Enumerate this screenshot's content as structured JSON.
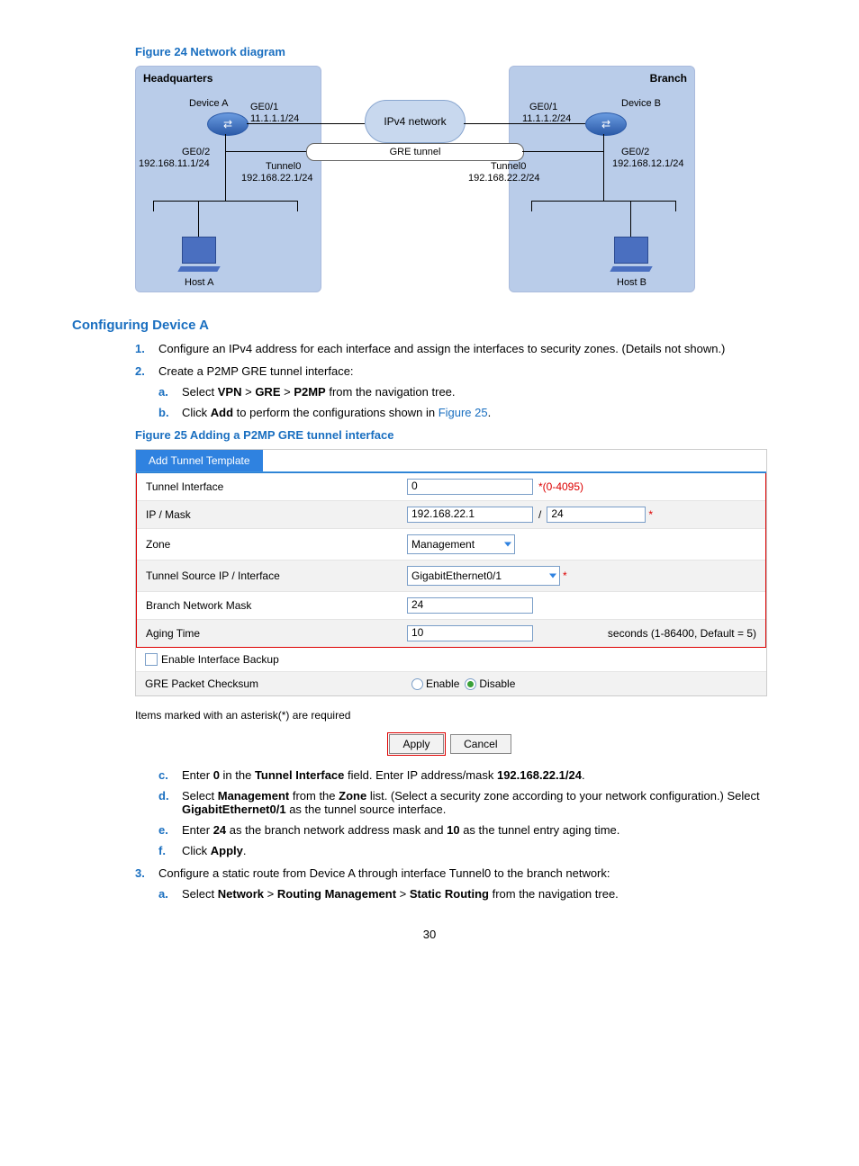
{
  "figure24": {
    "caption": "Figure 24 Network diagram",
    "hq_label": "Headquarters",
    "branch_label": "Branch",
    "deviceA": "Device A",
    "deviceB": "Device B",
    "ge01": "GE0/1",
    "ge02": "GE0/2",
    "ipA_ge01": "11.1.1.1/24",
    "ipB_ge01": "11.1.1.2/24",
    "ipA_ge02": "192.168.11.1/24",
    "ipB_ge02": "192.168.12.1/24",
    "cloud_label": "IPv4 network",
    "tunnel_label": "GRE tunnel",
    "tunnel0": "Tunnel0",
    "tunnelA_ip": "192.168.22.1/24",
    "tunnelB_ip": "192.168.22.2/24",
    "hostA": "Host A",
    "hostB": "Host B"
  },
  "section_heading": "Configuring Device A",
  "steps": {
    "s1": "Configure an IPv4 address for each interface and assign the interfaces to security zones. (Details not shown.)",
    "s2": "Create a P2MP GRE tunnel interface:",
    "s2a_pre": "Select ",
    "s2a_b1": "VPN",
    "s2a_gt1": " > ",
    "s2a_b2": "GRE",
    "s2a_gt2": " > ",
    "s2a_b3": "P2MP",
    "s2a_post": " from the navigation tree.",
    "s2b_pre": "Click ",
    "s2b_b": "Add",
    "s2b_mid": " to perform the configurations shown in ",
    "s2b_link": "Figure 25",
    "s2b_post": ".",
    "s2c_pre": "Enter ",
    "s2c_b1": "0",
    "s2c_mid1": " in the ",
    "s2c_b2": "Tunnel Interface",
    "s2c_mid2": " field. Enter IP address/mask ",
    "s2c_b3": "192.168.22.1/24",
    "s2c_post": ".",
    "s2d_pre": "Select ",
    "s2d_b1": "Management",
    "s2d_mid1": " from the ",
    "s2d_b2": "Zone",
    "s2d_mid2": " list. (Select a security zone according to your network configuration.) Select ",
    "s2d_b3": "GigabitEthernet0/1",
    "s2d_post": " as the tunnel source interface.",
    "s2e_pre": "Enter ",
    "s2e_b1": "24",
    "s2e_mid1": " as the branch network address mask and ",
    "s2e_b2": "10",
    "s2e_post": " as the tunnel entry aging time.",
    "s2f_pre": "Click ",
    "s2f_b": "Apply",
    "s2f_post": ".",
    "s3": "Configure a static route from Device A through interface Tunnel0 to the branch network:",
    "s3a_pre": "Select ",
    "s3a_b1": "Network",
    "s3a_gt1": " > ",
    "s3a_b2": "Routing Management",
    "s3a_gt2": " > ",
    "s3a_b3": "Static Routing",
    "s3a_post": " from the navigation tree."
  },
  "figure25": {
    "caption": "Figure 25 Adding a P2MP GRE tunnel interface",
    "tab_title": "Add Tunnel Template",
    "rows": {
      "tunnel_if_lbl": "Tunnel Interface",
      "tunnel_if_val": "0",
      "tunnel_if_hint": "*(0-4095)",
      "ipmask_lbl": "IP / Mask",
      "ip_val": "192.168.22.1",
      "mask_sep": "/",
      "mask_val": "24",
      "zone_lbl": "Zone",
      "zone_val": "Management",
      "src_lbl": "Tunnel Source IP / Interface",
      "src_val": "GigabitEthernet0/1",
      "bnm_lbl": "Branch Network Mask",
      "bnm_val": "24",
      "aging_lbl": "Aging Time",
      "aging_val": "10",
      "aging_hint": "seconds (1-86400, Default = 5)",
      "backup_lbl": "Enable Interface Backup",
      "checksum_lbl": "GRE Packet Checksum",
      "enable_lbl": "Enable",
      "disable_lbl": "Disable"
    },
    "note": "Items marked with an asterisk(*) are required",
    "apply_btn": "Apply",
    "cancel_btn": "Cancel"
  },
  "page_number": "30"
}
